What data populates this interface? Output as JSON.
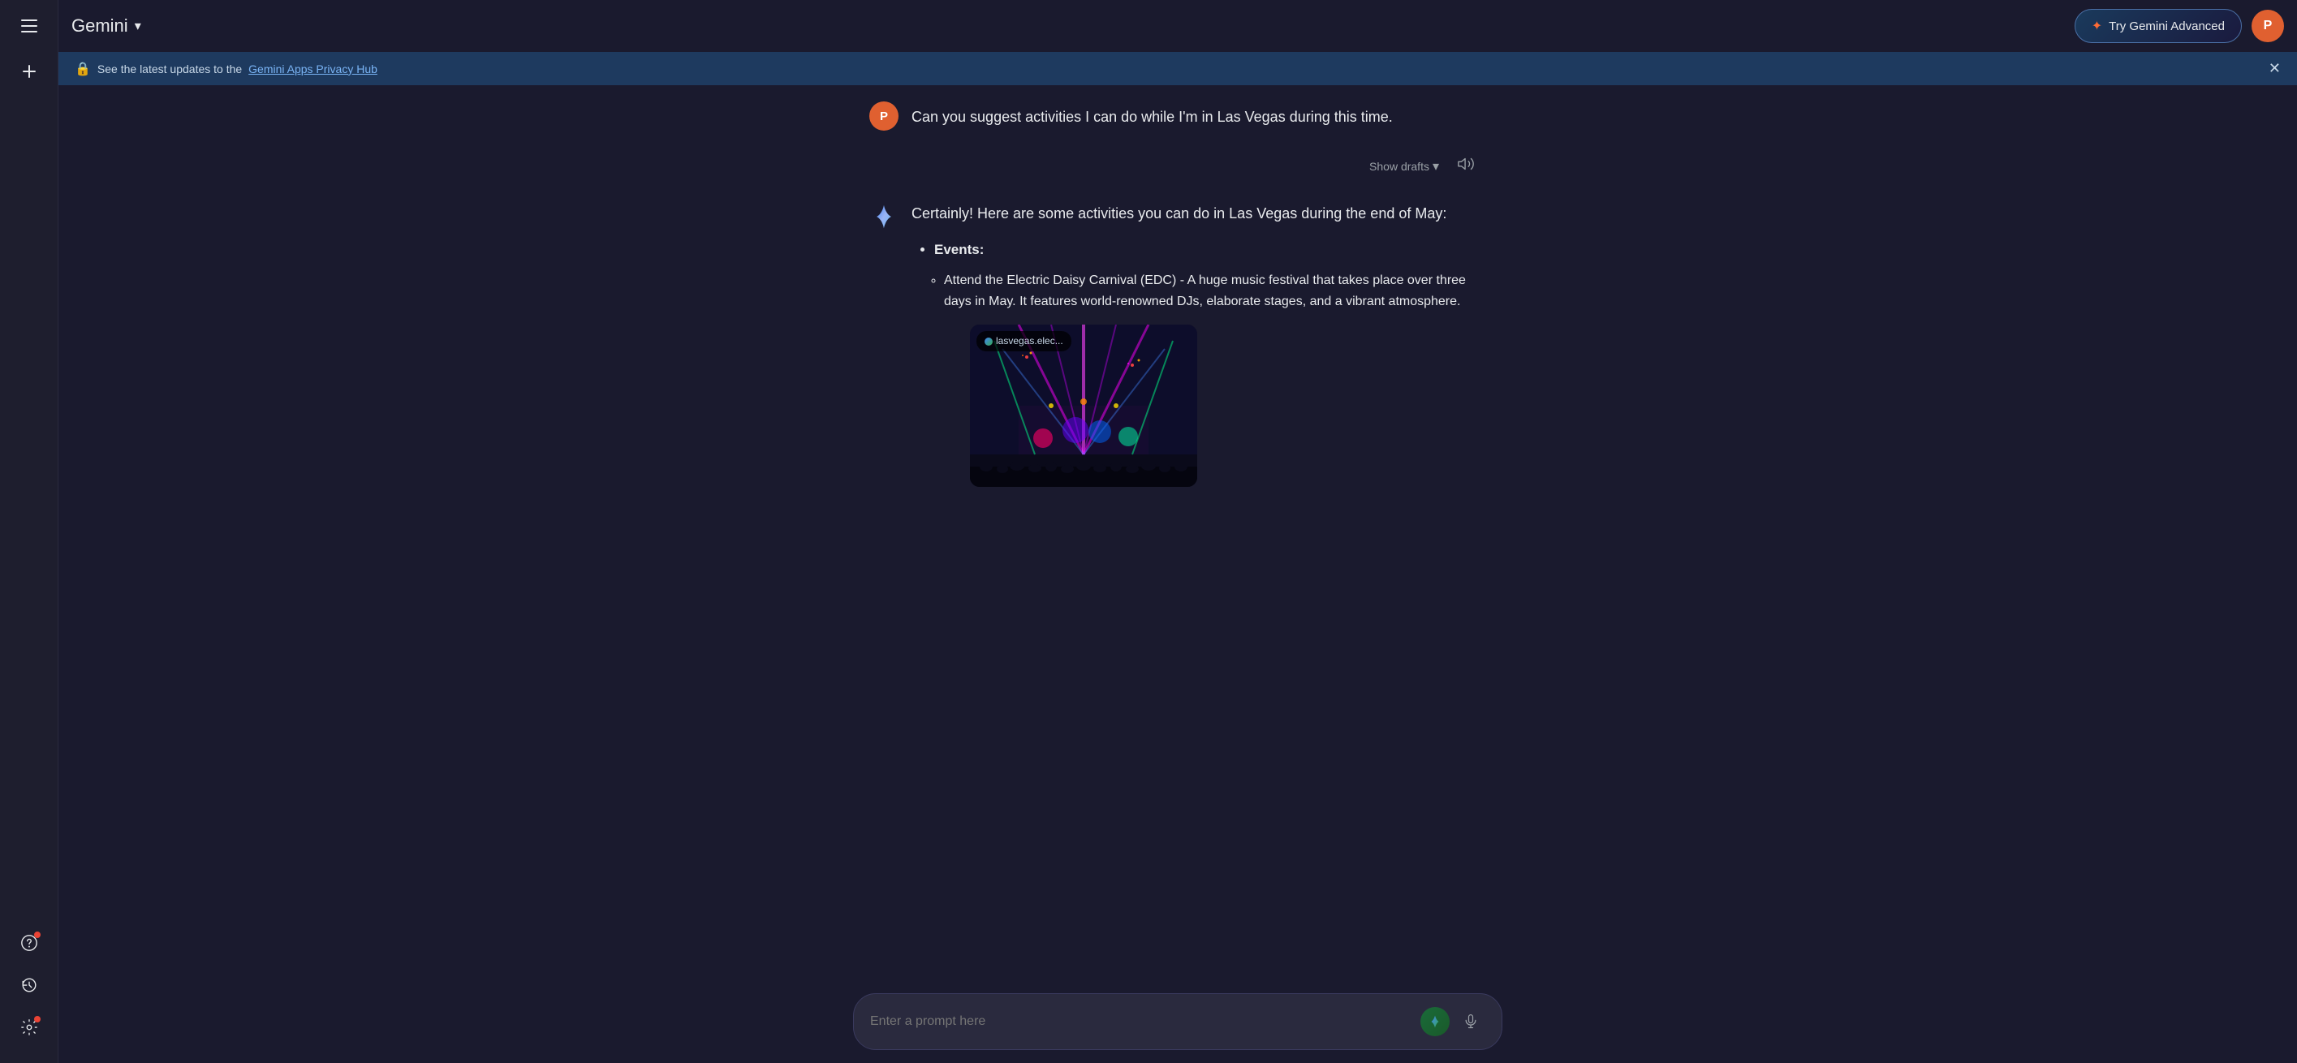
{
  "app": {
    "title": "Gemini",
    "avatar_letter": "P"
  },
  "header": {
    "title": "Gemini",
    "dropdown_label": "▾",
    "try_advanced_label": "Try Gemini Advanced",
    "avatar_letter": "P"
  },
  "banner": {
    "text_prefix": "See the latest updates to the",
    "link_text": "Gemini Apps Privacy Hub",
    "text_suffix": ""
  },
  "sidebar": {
    "hamburger_label": "Menu",
    "new_chat_label": "New chat",
    "help_label": "Help",
    "history_label": "History",
    "settings_label": "Settings"
  },
  "chat": {
    "user_avatar_letter": "P",
    "user_message": "Can you suggest activities I can do while I'm in Las Vegas during this time.",
    "show_drafts_label": "Show drafts",
    "ai_intro": "Certainly! Here are some activities you can do in Las Vegas during the end of May:",
    "events_label": "Events:",
    "sub_item_text": "Attend the Electric Daisy Carnival (EDC) - A huge music festival that takes place over three days in May. It features world-renowned DJs, elaborate stages, and a vibrant atmosphere.",
    "image_source": "lasvegas.elec..."
  },
  "input": {
    "placeholder": "Enter a prompt here"
  },
  "colors": {
    "accent_blue": "#4a90d9",
    "accent_orange": "#e06030",
    "brand_gradient_start": "#4285f4",
    "brand_gradient_end": "#34a853",
    "background": "#1a1a2e",
    "sidebar_bg": "#1e1e2e",
    "banner_bg": "#1e3a5f"
  }
}
